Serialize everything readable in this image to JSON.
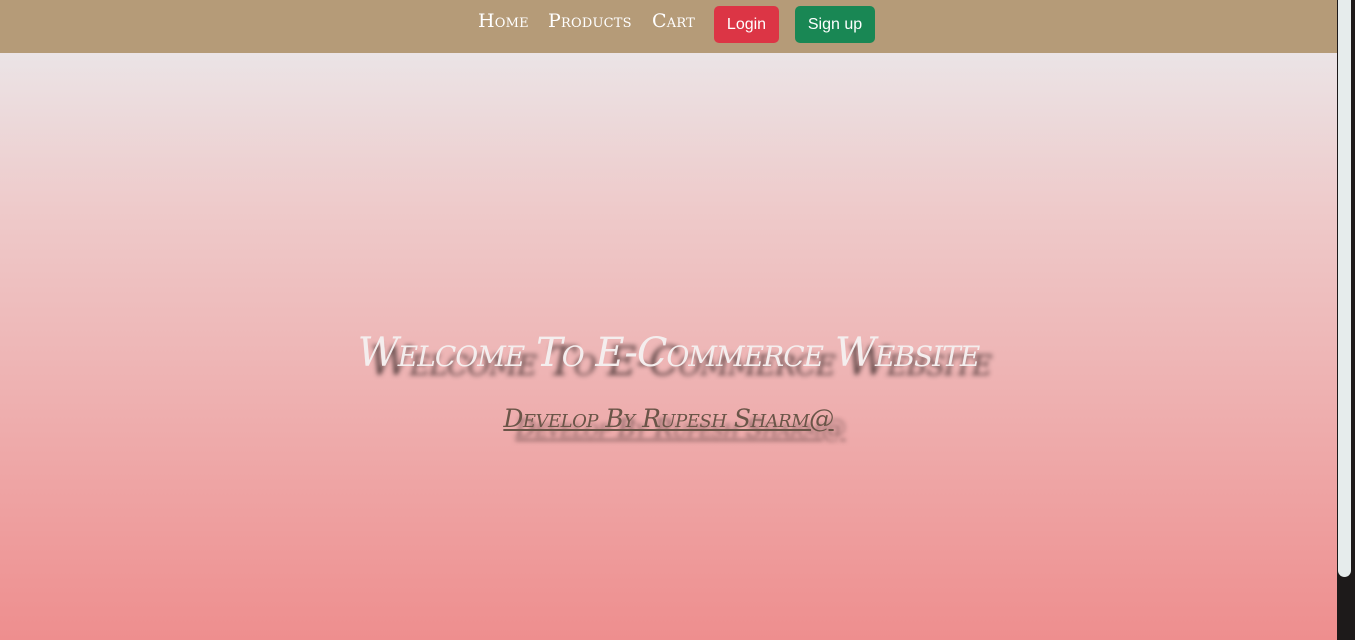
{
  "nav": {
    "home_label": "Home",
    "products_label": "Products",
    "cart_label": "Cart",
    "login_label": "Login",
    "signup_label": "Sign up"
  },
  "hero": {
    "title": "Welcome To E-Commerce Website",
    "subtitle": "Develop By Rupesh Sharm@"
  },
  "colors": {
    "navbar": "#b59b78",
    "login_button": "#dc3545",
    "signup_button": "#198754",
    "gradient_top": "#ebe4e6",
    "gradient_bottom": "#ee8e8e"
  }
}
